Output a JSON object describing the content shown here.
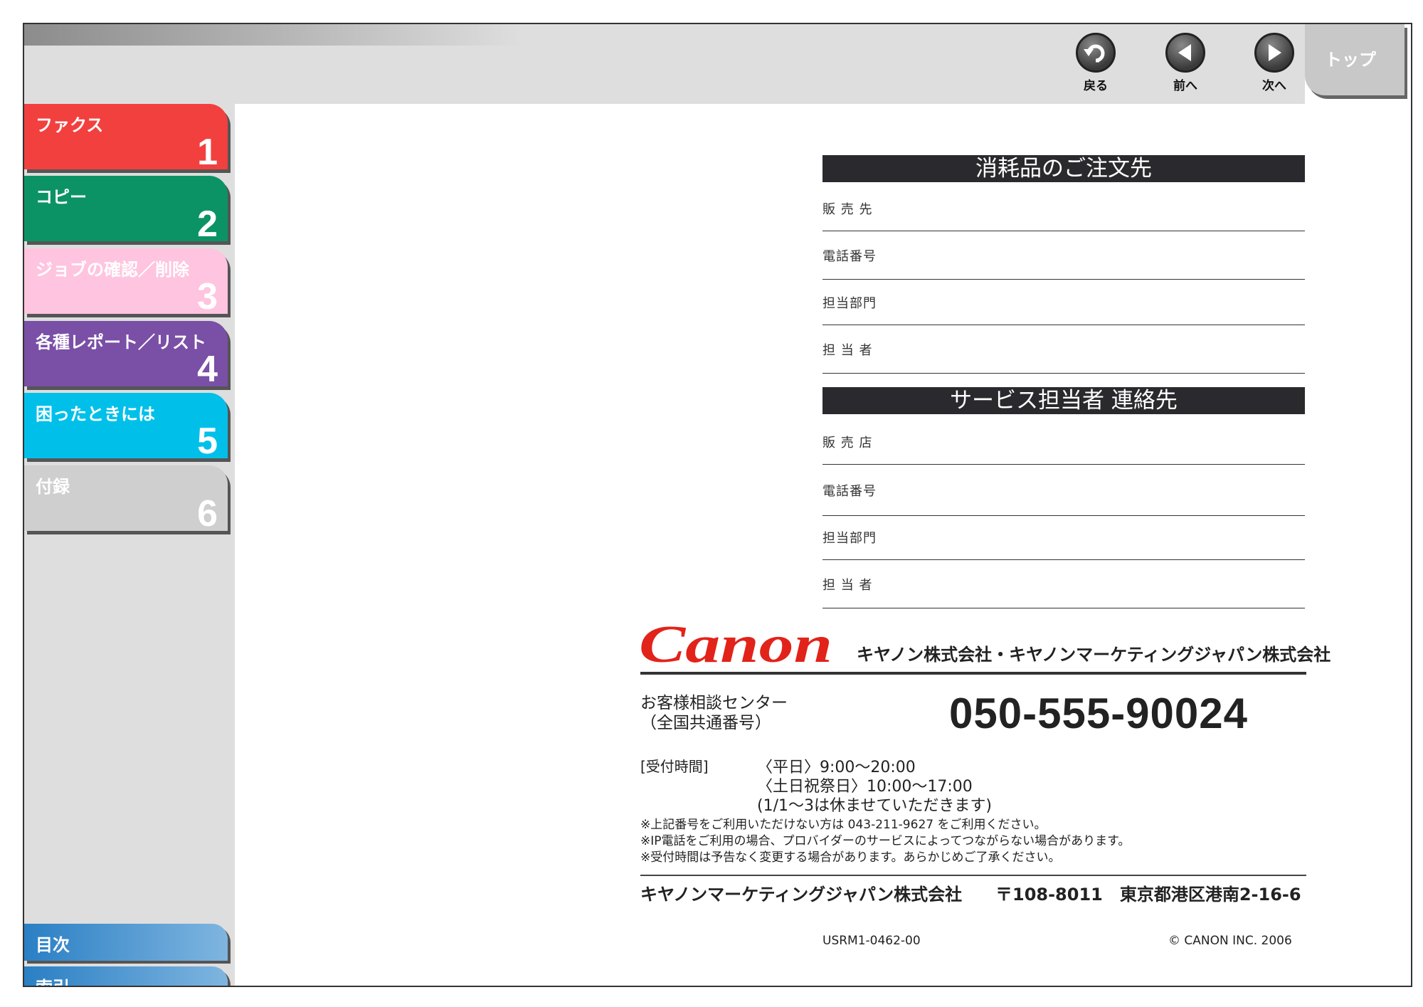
{
  "nav": {
    "back_label": "戻る",
    "prev_label": "前へ",
    "next_label": "次へ",
    "top_label": "トップ"
  },
  "chapters": [
    {
      "title": "ファクス",
      "num": "1",
      "color": "#f2403f"
    },
    {
      "title": "コピー",
      "num": "2",
      "color": "#0b9366"
    },
    {
      "title": "ジョブの確認／削除",
      "num": "3",
      "color": "#ffc4df"
    },
    {
      "title": "各種レポート／リスト",
      "num": "4",
      "color": "#7a4fa6"
    },
    {
      "title": "困ったときには",
      "num": "5",
      "color": "#00c0ea"
    },
    {
      "title": "付録",
      "num": "6",
      "color": "#cfcfcf"
    }
  ],
  "bottom_nav": {
    "contents": "目次",
    "index": "索引"
  },
  "supplies": {
    "heading": "消耗品のご注文先",
    "fields": [
      "販 売 先",
      "電話番号",
      "担当部門",
      "担 当 者"
    ]
  },
  "service": {
    "heading": "サービス担当者 連絡先",
    "fields": [
      "販 売 店",
      "電話番号",
      "担当部門",
      "担 当 者"
    ]
  },
  "canon": {
    "logo_text": "Canon",
    "companies": "キヤノン株式会社・キヤノンマーケティングジャパン株式会社",
    "center_line1": "お客様相談センター",
    "center_line2": "（全国共通番号）",
    "phone": "050-555-90024",
    "hours_label": "[受付時間]",
    "hours_weekday": "〈平日〉9:00〜20:00",
    "hours_weekend": "〈土日祝祭日〉10:00〜17:00",
    "hours_holiday": "(1/1〜3は休ませていただきます)",
    "note1": "※上記番号をご利用いただけない方は 043-211-9627 をご利用ください。",
    "note2": "※IP電話をご利用の場合、プロバイダーのサービスによってつながらない場合があります。",
    "note3": "※受付時間は予告なく変更する場合があります。あらかじめご了承ください。",
    "company_name": "キヤノンマーケティングジャパン株式会社",
    "address": "〒108-8011　東京都港区港南2-16-6",
    "code": "USRM1-0462-00",
    "copyright": "© CANON INC. 2006",
    "logo_color": "#e2231a"
  }
}
